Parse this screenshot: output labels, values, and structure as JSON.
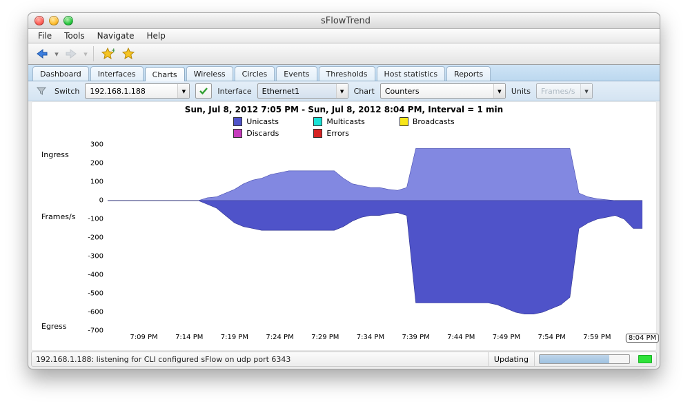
{
  "window": {
    "title": "sFlowTrend"
  },
  "menu": [
    "File",
    "Tools",
    "Navigate",
    "Help"
  ],
  "toolbar": {
    "back": "back-button",
    "fwd": "forward-button",
    "fav_add": "add-favorite-button",
    "fav": "favorites-button"
  },
  "tabs": [
    "Dashboard",
    "Interfaces",
    "Charts",
    "Wireless",
    "Circles",
    "Events",
    "Thresholds",
    "Host statistics",
    "Reports"
  ],
  "active_tab": 2,
  "selectors": {
    "switch_label": "Switch",
    "switch_value": "192.168.1.188",
    "interface_label": "Interface",
    "interface_value": "Ethernet1",
    "chart_label": "Chart",
    "chart_value": "Counters",
    "units_label": "Units",
    "units_value": "Frames/s"
  },
  "legend": {
    "row1": [
      {
        "label": "Unicasts",
        "color": "#4f53c9"
      },
      {
        "label": "Multicasts",
        "color": "#19e2d6"
      },
      {
        "label": "Broadcasts",
        "color": "#f7e619"
      }
    ],
    "row2": [
      {
        "label": "Discards",
        "color": "#c63bbd"
      },
      {
        "label": "Errors",
        "color": "#d62323"
      }
    ]
  },
  "status": {
    "message": "192.168.1.188: listening for CLI configured sFlow on udp port 6343",
    "state": "Updating",
    "progress_pct": 78
  },
  "chart_data": {
    "type": "area",
    "title": "Sun, Jul 8, 2012 7:05 PM - Sun, Jul 8, 2012 8:04 PM, Interval = 1 min",
    "xlabel": "",
    "ylabel": "Frames/s",
    "direction_labels": {
      "top": "Ingress",
      "bottom": "Egress"
    },
    "y_ticks_ingress": [
      300,
      200,
      100,
      0
    ],
    "y_ticks_egress": [
      100,
      200,
      300,
      400,
      500,
      600,
      700
    ],
    "x_ticks": [
      "7:09 PM",
      "7:14 PM",
      "7:19 PM",
      "7:24 PM",
      "7:29 PM",
      "7:34 PM",
      "7:39 PM",
      "7:44 PM",
      "7:49 PM",
      "7:54 PM",
      "7:59 PM",
      "8:04 PM"
    ],
    "x_range_minutes": [
      5,
      64
    ],
    "colors": {
      "ingress": "#8288e1",
      "egress": "#4f53c9"
    },
    "series": [
      {
        "name": "Unicasts_Ingress",
        "minute": [
          5,
          15,
          16,
          17,
          18,
          19,
          20,
          21,
          22,
          23,
          24,
          25,
          26,
          27,
          28,
          29,
          30,
          31,
          32,
          33,
          34,
          35,
          36,
          37,
          38,
          39,
          40,
          41,
          42,
          43,
          44,
          45,
          46,
          47,
          48,
          49,
          50,
          51,
          52,
          53,
          54,
          55,
          56,
          57,
          58,
          59,
          60,
          61,
          62,
          63,
          64
        ],
        "values": [
          0,
          0,
          15,
          20,
          40,
          60,
          90,
          110,
          120,
          140,
          150,
          160,
          160,
          160,
          160,
          160,
          160,
          120,
          90,
          80,
          70,
          70,
          60,
          55,
          70,
          280,
          280,
          280,
          280,
          280,
          280,
          280,
          280,
          280,
          280,
          280,
          280,
          280,
          280,
          280,
          280,
          280,
          280,
          40,
          20,
          10,
          5,
          0,
          0,
          0,
          0
        ]
      },
      {
        "name": "Unicasts_Egress",
        "minute": [
          5,
          15,
          16,
          17,
          18,
          19,
          20,
          21,
          22,
          23,
          24,
          25,
          26,
          27,
          28,
          29,
          30,
          31,
          32,
          33,
          34,
          35,
          36,
          37,
          38,
          39,
          40,
          41,
          42,
          43,
          44,
          45,
          46,
          47,
          48,
          49,
          50,
          51,
          52,
          53,
          54,
          55,
          56,
          57,
          58,
          59,
          60,
          61,
          62,
          63,
          64
        ],
        "values": [
          0,
          0,
          -20,
          -40,
          -80,
          -120,
          -140,
          -150,
          -160,
          -160,
          -160,
          -160,
          -160,
          -160,
          -160,
          -160,
          -160,
          -140,
          -110,
          -90,
          -80,
          -80,
          -70,
          -65,
          -80,
          -550,
          -550,
          -550,
          -550,
          -550,
          -550,
          -550,
          -550,
          -550,
          -560,
          -580,
          -600,
          -610,
          -610,
          -600,
          -580,
          -560,
          -520,
          -150,
          -120,
          -100,
          -90,
          -80,
          -100,
          -150,
          -150
        ]
      }
    ]
  }
}
